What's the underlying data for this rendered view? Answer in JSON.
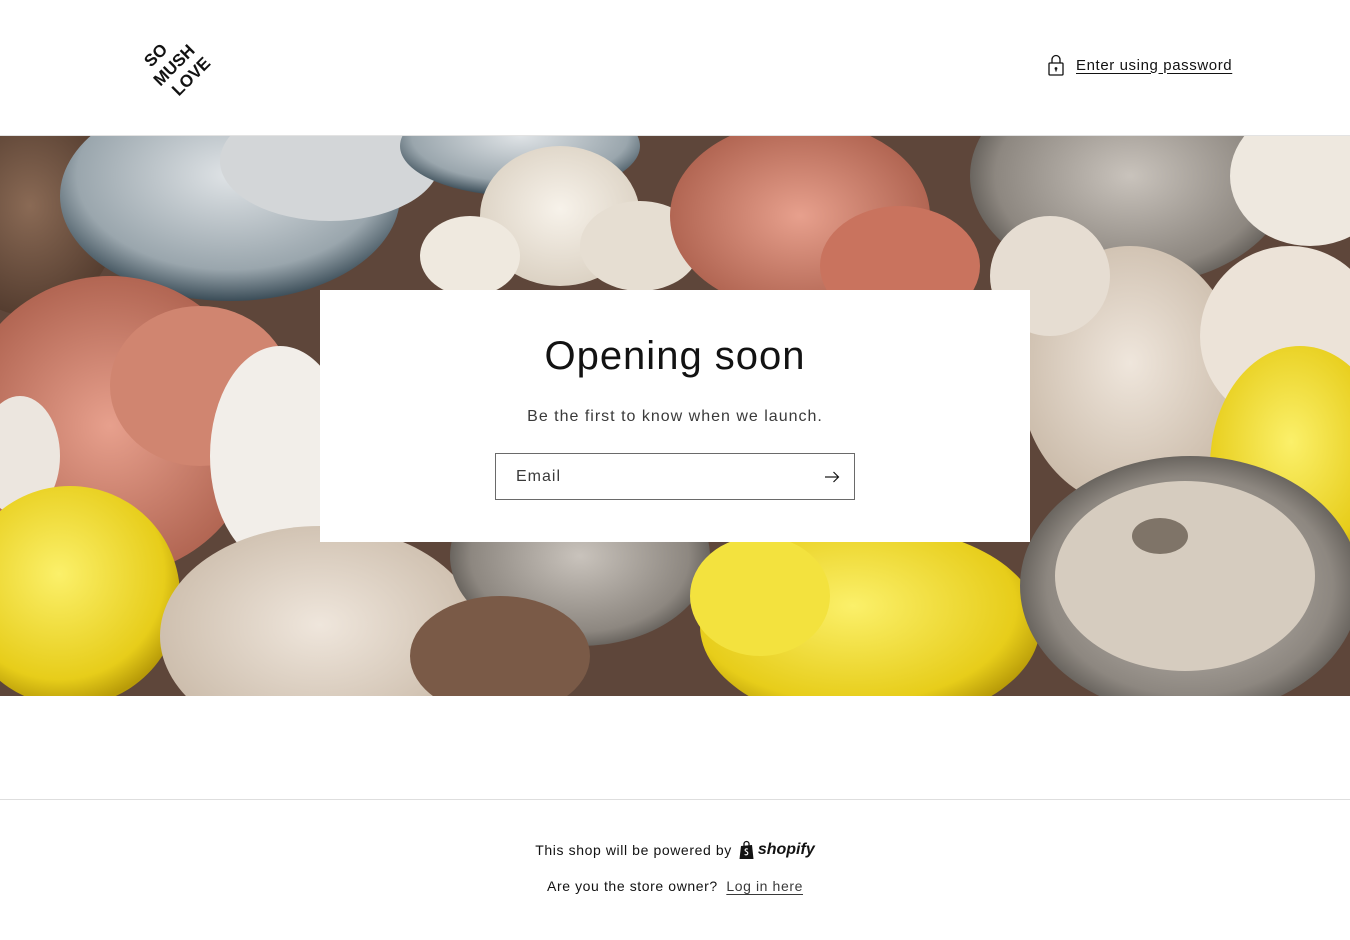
{
  "header": {
    "logo_text": [
      "SO",
      "MUSH",
      "LOVE"
    ],
    "password_link": "Enter using password",
    "lock_icon": "lock-icon"
  },
  "hero": {
    "image_subject": "assorted mushrooms",
    "title": "Opening soon",
    "subtitle": "Be the first to know when we launch.",
    "email_placeholder": "Email",
    "submit_icon": "arrow-right-icon"
  },
  "footer": {
    "powered_text": "This shop will be powered by",
    "shopify_label": "shopify",
    "owner_text": "Are you the store owner?",
    "login_link": "Log in here"
  },
  "colors": {
    "text": "#121212",
    "border": "#e3e3e3"
  }
}
